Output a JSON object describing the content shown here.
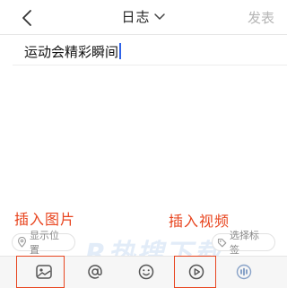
{
  "header": {
    "title": "日志",
    "publish_label": "发表"
  },
  "editor": {
    "title_text": "运动会精彩瞬间"
  },
  "annotations": {
    "insert_image": "插入图片",
    "insert_video": "插入视频"
  },
  "footer": {
    "location_label": "显示位置",
    "tags_label": "选择标签",
    "watermark_text": "R热搜下载"
  },
  "toolbar": {
    "icons": [
      "image-icon",
      "mention-icon",
      "emoji-icon",
      "video-icon",
      "audio-icon"
    ]
  },
  "colors": {
    "accent_caret": "#2f63e8",
    "annotation_red": "#e8451f",
    "publish_disabled": "#b5b5b5"
  }
}
